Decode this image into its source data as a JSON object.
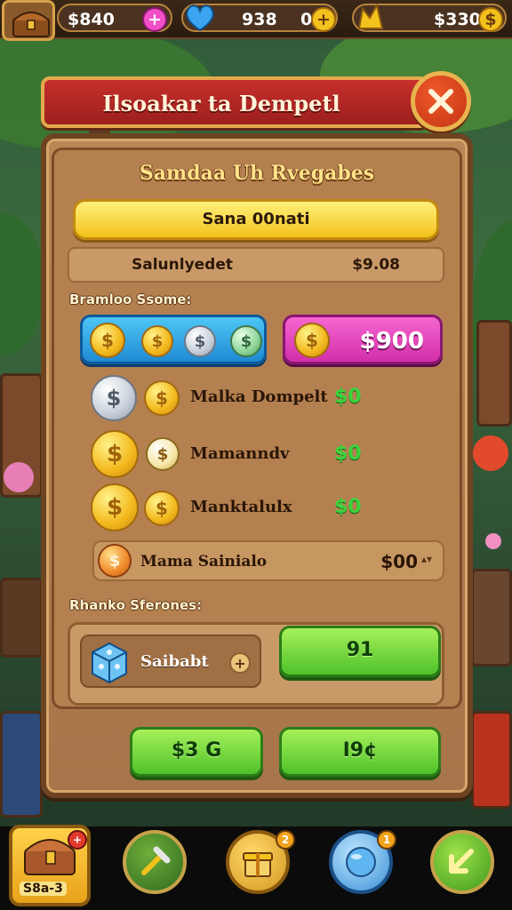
{
  "topbar": {
    "res1_value": "$840",
    "res2_value": "938",
    "res2_sub": "0",
    "res3_value": "$330"
  },
  "dialog": {
    "title": "Ilsoakar ta Dempetl",
    "subtitle": "Samdaa Uh Rvegabes",
    "yellow_bar": "Sana 00nati",
    "summary_label": "Salunlyedet",
    "summary_value": "$9.08",
    "section1_label": "Bramloo Ssome:",
    "gem_tab_value": "$900",
    "items": [
      {
        "label": "Malka Dompelt",
        "value": "$0"
      },
      {
        "label": "Mamanndv",
        "value": "$0"
      },
      {
        "label": "Manktalulx",
        "value": "$0"
      }
    ],
    "bonus_label": "Mama Sainialo",
    "bonus_value": "$00",
    "section2_label": "Rhanko Sferones:",
    "store_item_label": "Saibabt",
    "store_buy_label": "91",
    "btn_left_label": "$3 G",
    "btn_right_label": "I9¢",
    "icons": {
      "coin": "$",
      "plus": "+",
      "close": "close-icon"
    }
  },
  "bottom_nav": {
    "first_label": "S8a-3",
    "badge_2": "2",
    "badge_3": "1"
  },
  "colors": {
    "accent_gold": "#f3c21c",
    "banner_red": "#c7302c",
    "gem_pink": "#e040b9",
    "action_green": "#4fc22a",
    "value_green": "#3bd33b"
  }
}
